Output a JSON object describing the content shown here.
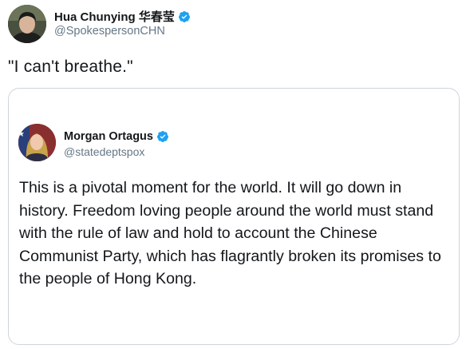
{
  "tweet": {
    "author": {
      "display_name": "Hua Chunying 华春莹",
      "handle": "@SpokespersonCHN",
      "verified": true
    },
    "text": "\"I can't breathe.\""
  },
  "quoted_tweet": {
    "author": {
      "display_name": "Morgan Ortagus",
      "handle": "@statedeptspox",
      "verified": true
    },
    "text": "This is a pivotal moment for the world. It will go down in history. Freedom loving people around the world must stand with the rule of law and hold to account the Chinese Communist Party, which has flagrantly broken its promises to the people of Hong Kong."
  },
  "colors": {
    "text_primary": "#14171a",
    "text_secondary": "#657786",
    "verified_blue": "#1da1f2",
    "card_border": "#ccd6dd"
  },
  "icons": {
    "verified": "verified-badge-icon",
    "avatar": "user-avatar-image"
  }
}
